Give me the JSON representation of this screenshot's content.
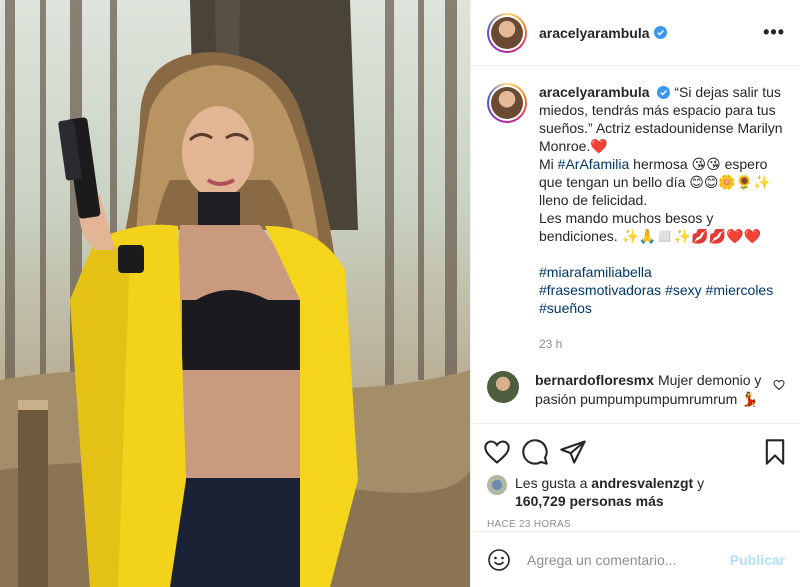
{
  "post": {
    "author": "aracelyarambula",
    "verified": true,
    "more_icon": "more-horizontal-icon"
  },
  "caption": {
    "author": "aracelyarambula",
    "p1": "“Si dejas salir tus miedos, tendrás más espacio para tus sueños.” Actriz estadounidense Marilyn Monroe.❤️",
    "p2_prefix": "Mi ",
    "p2_hashtag": "#ArAfamilia",
    "p2_rest": " hermosa 😘😘 espero que tengan un bello día 😊😊🌼🌻✨ lleno de felicidad.",
    "p3": "Les mando muchos besos y bendiciones. ✨🙏◻️✨💋💋❤️❤️",
    "hashtags": [
      "#miarafamiliabella",
      "#frasesmotivadoras",
      "#sexy",
      "#miercoles",
      "#sueños"
    ],
    "time": "23 h"
  },
  "comment": {
    "author": "bernardofloresmx",
    "text": "Mujer demonio y pasión pumpumpumpumrumrum 💃"
  },
  "likes": {
    "prefix": "Les gusta a ",
    "user": "andresvalenzgt",
    "joiner": " y",
    "count": "160,729 personas más"
  },
  "date": "HACE 23 HORAS",
  "add_comment": {
    "placeholder": "Agrega un comentario...",
    "publish": "Publicar"
  }
}
